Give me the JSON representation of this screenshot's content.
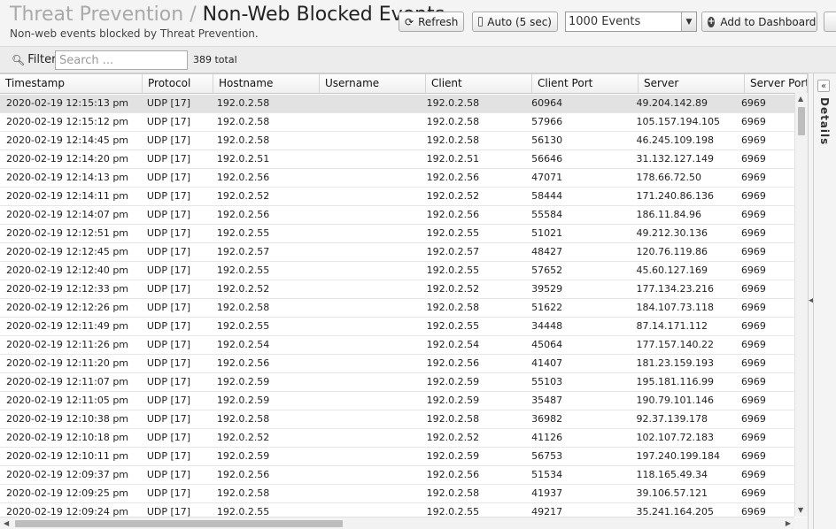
{
  "header": {
    "crumb": "Threat Prevention",
    "separator": "/",
    "title": "Non-Web Blocked Events",
    "subtitle": "Non-web events blocked by Threat Prevention."
  },
  "toolbar": {
    "refresh_label": "Refresh",
    "refresh_icon": "refresh-icon",
    "auto_label": "Auto (5 sec)",
    "auto_checked": false,
    "events_select_value": "1000 Events",
    "add_dashboard_label": "Add to Dashboard",
    "add_dashboard_icon": "plus-circle-icon"
  },
  "filter": {
    "label": "Filter",
    "icon": "search-icon",
    "placeholder": "Search ...",
    "value": "",
    "total": "389 total"
  },
  "table": {
    "columns": [
      "Timestamp",
      "Protocol",
      "Hostname",
      "Username",
      "Client",
      "Client Port",
      "Server",
      "Server Port"
    ],
    "selected_row": 0,
    "rows": [
      [
        "2020-02-19 12:15:13 pm",
        "UDP [17]",
        "192.0.2.58",
        "",
        "192.0.2.58",
        "60964",
        "49.204.142.89",
        "6969"
      ],
      [
        "2020-02-19 12:15:12 pm",
        "UDP [17]",
        "192.0.2.58",
        "",
        "192.0.2.58",
        "57966",
        "105.157.194.105",
        "6969"
      ],
      [
        "2020-02-19 12:14:45 pm",
        "UDP [17]",
        "192.0.2.58",
        "",
        "192.0.2.58",
        "56130",
        "46.245.109.198",
        "6969"
      ],
      [
        "2020-02-19 12:14:20 pm",
        "UDP [17]",
        "192.0.2.51",
        "",
        "192.0.2.51",
        "56646",
        "31.132.127.149",
        "6969"
      ],
      [
        "2020-02-19 12:14:13 pm",
        "UDP [17]",
        "192.0.2.56",
        "",
        "192.0.2.56",
        "47071",
        "178.66.72.50",
        "6969"
      ],
      [
        "2020-02-19 12:14:11 pm",
        "UDP [17]",
        "192.0.2.52",
        "",
        "192.0.2.52",
        "58444",
        "171.240.86.136",
        "6969"
      ],
      [
        "2020-02-19 12:14:07 pm",
        "UDP [17]",
        "192.0.2.56",
        "",
        "192.0.2.56",
        "55584",
        "186.11.84.96",
        "6969"
      ],
      [
        "2020-02-19 12:12:51 pm",
        "UDP [17]",
        "192.0.2.55",
        "",
        "192.0.2.55",
        "51021",
        "49.212.30.136",
        "6969"
      ],
      [
        "2020-02-19 12:12:45 pm",
        "UDP [17]",
        "192.0.2.57",
        "",
        "192.0.2.57",
        "48427",
        "120.76.119.86",
        "6969"
      ],
      [
        "2020-02-19 12:12:40 pm",
        "UDP [17]",
        "192.0.2.55",
        "",
        "192.0.2.55",
        "57652",
        "45.60.127.169",
        "6969"
      ],
      [
        "2020-02-19 12:12:33 pm",
        "UDP [17]",
        "192.0.2.52",
        "",
        "192.0.2.52",
        "39529",
        "177.134.23.216",
        "6969"
      ],
      [
        "2020-02-19 12:12:26 pm",
        "UDP [17]",
        "192.0.2.58",
        "",
        "192.0.2.58",
        "51622",
        "184.107.73.118",
        "6969"
      ],
      [
        "2020-02-19 12:11:49 pm",
        "UDP [17]",
        "192.0.2.55",
        "",
        "192.0.2.55",
        "34448",
        "87.14.171.112",
        "6969"
      ],
      [
        "2020-02-19 12:11:26 pm",
        "UDP [17]",
        "192.0.2.54",
        "",
        "192.0.2.54",
        "45064",
        "177.157.140.22",
        "6969"
      ],
      [
        "2020-02-19 12:11:20 pm",
        "UDP [17]",
        "192.0.2.56",
        "",
        "192.0.2.56",
        "41407",
        "181.23.159.193",
        "6969"
      ],
      [
        "2020-02-19 12:11:07 pm",
        "UDP [17]",
        "192.0.2.59",
        "",
        "192.0.2.59",
        "55103",
        "195.181.116.99",
        "6969"
      ],
      [
        "2020-02-19 12:11:05 pm",
        "UDP [17]",
        "192.0.2.59",
        "",
        "192.0.2.59",
        "35487",
        "190.79.101.146",
        "6969"
      ],
      [
        "2020-02-19 12:10:38 pm",
        "UDP [17]",
        "192.0.2.58",
        "",
        "192.0.2.58",
        "36982",
        "92.37.139.178",
        "6969"
      ],
      [
        "2020-02-19 12:10:18 pm",
        "UDP [17]",
        "192.0.2.52",
        "",
        "192.0.2.52",
        "41126",
        "102.107.72.183",
        "6969"
      ],
      [
        "2020-02-19 12:10:11 pm",
        "UDP [17]",
        "192.0.2.59",
        "",
        "192.0.2.59",
        "56753",
        "197.240.199.184",
        "6969"
      ],
      [
        "2020-02-19 12:09:37 pm",
        "UDP [17]",
        "192.0.2.56",
        "",
        "192.0.2.56",
        "51534",
        "118.165.49.34",
        "6969"
      ],
      [
        "2020-02-19 12:09:25 pm",
        "UDP [17]",
        "192.0.2.58",
        "",
        "192.0.2.58",
        "41937",
        "39.106.57.121",
        "6969"
      ],
      [
        "2020-02-19 12:09:24 pm",
        "UDP [17]",
        "192.0.2.55",
        "",
        "192.0.2.55",
        "49217",
        "35.241.164.205",
        "6969"
      ]
    ]
  },
  "details_panel": {
    "label": "Details",
    "collapse_icon": "double-chevron-left-icon"
  }
}
